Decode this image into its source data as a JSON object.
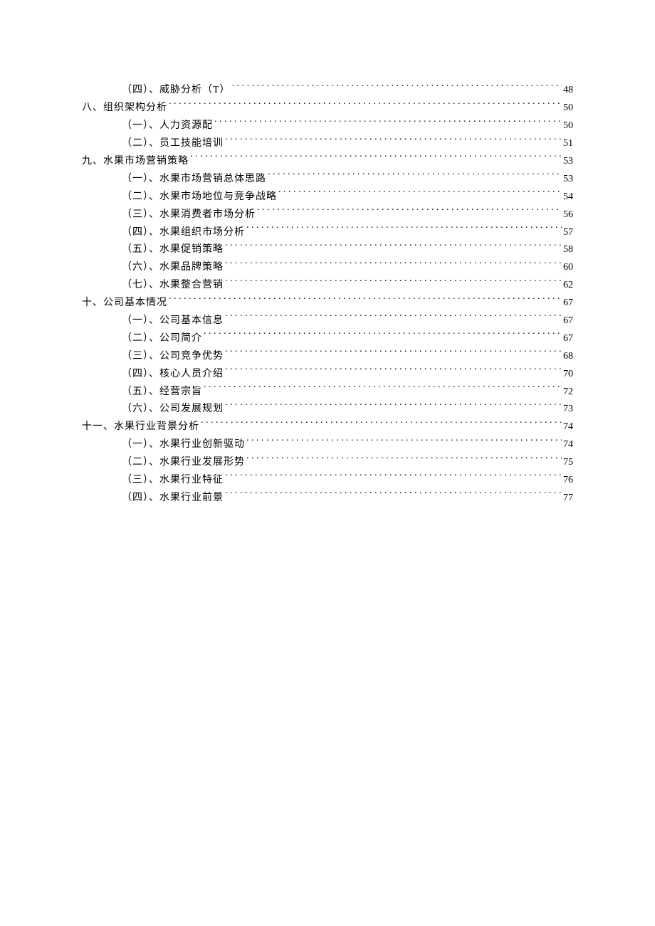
{
  "toc": [
    {
      "level": 2,
      "label": "（四）、威胁分析（T）",
      "page": "48"
    },
    {
      "level": 1,
      "label": "八、组织架构分析",
      "page": "50"
    },
    {
      "level": 2,
      "label": "（一）、人力资源配",
      "page": "50"
    },
    {
      "level": 2,
      "label": "（二）、员工技能培训",
      "page": "51"
    },
    {
      "level": 1,
      "label": "九、水果市场营销策略",
      "page": "53"
    },
    {
      "level": 2,
      "label": "（一）、水果市场营销总体思路",
      "page": "53"
    },
    {
      "level": 2,
      "label": "（二）、水果市场地位与竞争战略",
      "page": "54"
    },
    {
      "level": 2,
      "label": "（三）、水果消费者市场分析",
      "page": "56"
    },
    {
      "level": 2,
      "label": "（四）、水果组织市场分析",
      "page": "57"
    },
    {
      "level": 2,
      "label": "（五）、水果促销策略",
      "page": "58"
    },
    {
      "level": 2,
      "label": "（六）、水果品牌策略",
      "page": "60"
    },
    {
      "level": 2,
      "label": "（七）、水果整合营销",
      "page": "62"
    },
    {
      "level": 1,
      "label": "十、公司基本情况",
      "page": "67"
    },
    {
      "level": 2,
      "label": "（一）、公司基本信息",
      "page": "67"
    },
    {
      "level": 2,
      "label": "（二）、公司简介",
      "page": "67"
    },
    {
      "level": 2,
      "label": "（三）、公司竞争优势",
      "page": "68"
    },
    {
      "level": 2,
      "label": "（四）、核心人员介绍",
      "page": "70"
    },
    {
      "level": 2,
      "label": "（五）、经营宗旨",
      "page": "72"
    },
    {
      "level": 2,
      "label": "（六）、公司发展规划",
      "page": "73"
    },
    {
      "level": 1,
      "label": "十一、水果行业背景分析",
      "page": "74"
    },
    {
      "level": 2,
      "label": "（一）、水果行业创新驱动",
      "page": "74"
    },
    {
      "level": 2,
      "label": "（二）、水果行业发展形势",
      "page": "75"
    },
    {
      "level": 2,
      "label": "（三）、水果行业特征",
      "page": "76"
    },
    {
      "level": 2,
      "label": "（四）、水果行业前景",
      "page": "77"
    }
  ]
}
